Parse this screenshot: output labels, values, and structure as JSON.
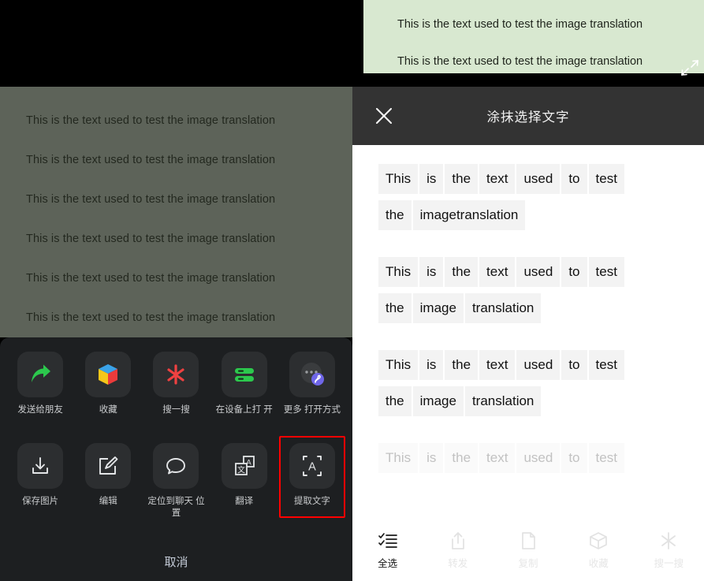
{
  "left": {
    "preview": {
      "lines": [
        "This is the text used to test the image translation",
        "This is the text used to test the image translation",
        "This is the text used to test the image translation",
        "This is the text used to test the image translation",
        "This is the text used to test the image translation",
        "This is the text used to test the image translation"
      ]
    },
    "share_sheet": {
      "row1": [
        {
          "label": "发送给朋友",
          "icon": "share-arrow-icon"
        },
        {
          "label": "收藏",
          "icon": "favorites-cube-icon"
        },
        {
          "label": "搜一搜",
          "icon": "search-asterisk-icon"
        },
        {
          "label": "在设备上打\n开",
          "icon": "open-on-device-icon"
        },
        {
          "label": "更多\n打开方式",
          "icon": "more-open-with-icon"
        }
      ],
      "row2": [
        {
          "label": "保存图片",
          "icon": "save-image-icon"
        },
        {
          "label": "编辑",
          "icon": "edit-pencil-icon"
        },
        {
          "label": "定位到聊天\n位置",
          "icon": "locate-chat-icon"
        },
        {
          "label": "翻译",
          "icon": "translate-icon"
        },
        {
          "label": "提取文字",
          "icon": "extract-text-icon"
        }
      ],
      "highlighted": "提取文字",
      "highlight_color": "#ff0000",
      "cancel_label": "取消"
    }
  },
  "right": {
    "banner": {
      "lines": [
        "This is the text used to test the image translation",
        "This is the text used to test the image translation"
      ],
      "background_color": "#d8e8d0",
      "resize_icon": "diagonal-resize-icon"
    },
    "ocr": {
      "title": "涂抹选择文字",
      "close_icon": "close-icon",
      "groups": [
        {
          "faded": false,
          "rows": [
            [
              "This",
              "is",
              "the",
              "text",
              "used",
              "to",
              "test"
            ],
            [
              "the",
              "imagetranslation"
            ]
          ]
        },
        {
          "faded": false,
          "rows": [
            [
              "This",
              "is",
              "the",
              "text",
              "used",
              "to",
              "test"
            ],
            [
              "the",
              "image",
              "translation"
            ]
          ]
        },
        {
          "faded": false,
          "rows": [
            [
              "This",
              "is",
              "the",
              "text",
              "used",
              "to",
              "test"
            ],
            [
              "the",
              "image",
              "translation"
            ]
          ]
        },
        {
          "faded": true,
          "rows": [
            [
              "This",
              "is",
              "the",
              "text",
              "used",
              "to",
              "test"
            ]
          ]
        }
      ],
      "toolbar": [
        {
          "label": "全选",
          "icon": "select-all-icon",
          "disabled": false
        },
        {
          "label": "转发",
          "icon": "forward-icon",
          "disabled": true
        },
        {
          "label": "复制",
          "icon": "copy-icon",
          "disabled": true
        },
        {
          "label": "收藏",
          "icon": "favorite-cube-icon",
          "disabled": true
        },
        {
          "label": "搜一搜",
          "icon": "search-asterisk-icon",
          "disabled": true
        }
      ]
    }
  }
}
